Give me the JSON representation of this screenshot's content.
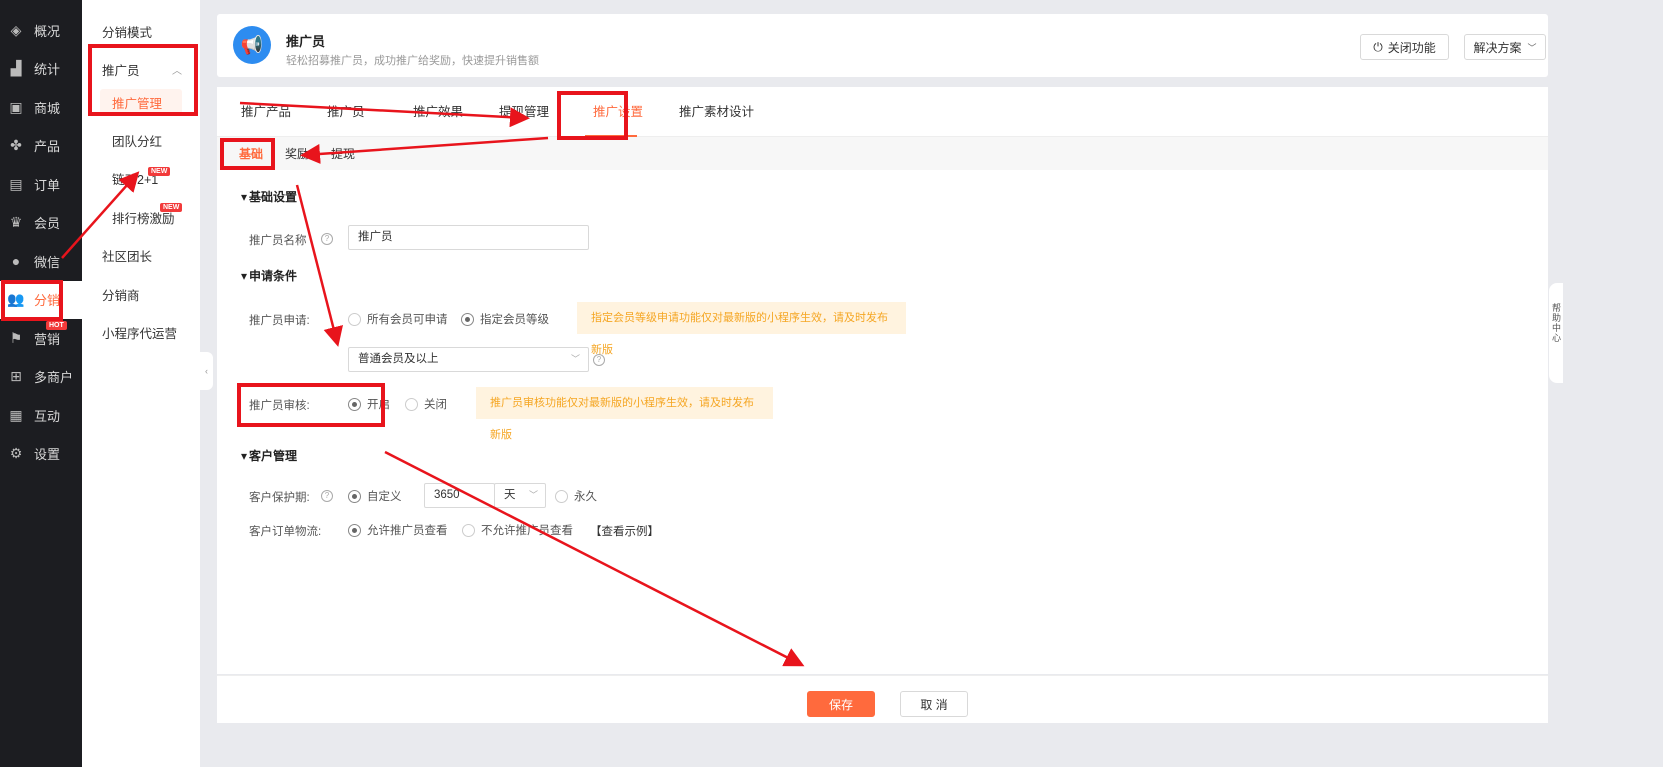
{
  "nav": [
    {
      "label": "概况",
      "icon": "layers-icon",
      "glyph": "◈"
    },
    {
      "label": "统计",
      "icon": "chart-icon",
      "glyph": "▟"
    },
    {
      "label": "商城",
      "icon": "store-icon",
      "glyph": "▣"
    },
    {
      "label": "产品",
      "icon": "product-icon",
      "glyph": "✤"
    },
    {
      "label": "订单",
      "icon": "order-icon",
      "glyph": "▤"
    },
    {
      "label": "会员",
      "icon": "crown-icon",
      "glyph": "♛"
    },
    {
      "label": "微信",
      "icon": "wechat-icon",
      "glyph": "●"
    },
    {
      "label": "分销",
      "icon": "users-icon",
      "glyph": "👥"
    },
    {
      "label": "营销",
      "icon": "flag-icon",
      "glyph": "⚑",
      "badge": "HOT"
    },
    {
      "label": "多商户",
      "icon": "merchant-icon",
      "glyph": "⊞"
    },
    {
      "label": "互动",
      "icon": "interact-icon",
      "glyph": "▦"
    },
    {
      "label": "设置",
      "icon": "gear-icon",
      "glyph": "⚙"
    }
  ],
  "sub": {
    "mode": "分销模式",
    "promoter": "推广员",
    "promoter_manage": "推广管理",
    "team_bonus": "团队分红",
    "linkage": "链动2+1",
    "ranking": "排行榜激励",
    "community": "社区团长",
    "distributor": "分销商",
    "miniapp": "小程序代运营",
    "new_badge": "NEW"
  },
  "header": {
    "title": "推广员",
    "desc": "轻松招募推广员，成功推广给奖励，快速提升销售额",
    "close_btn": "关闭功能",
    "solution_btn": "解决方案"
  },
  "tabs": [
    "推广产品",
    "推广员",
    "推广效果",
    "提现管理",
    "推广设置",
    "推广素材设计"
  ],
  "subtabs": [
    "基础",
    "奖励",
    "提现"
  ],
  "form": {
    "sec_basic": "基础设置",
    "name_label": "推广员名称",
    "name_value": "推广员",
    "sec_apply": "申请条件",
    "apply_label": "推广员申请:",
    "apply_all": "所有会员可申请",
    "apply_level": "指定会员等级",
    "apply_tip": "指定会员等级申请功能仅对最新版的小程序生效，请及时发布新版",
    "level_select": "普通会员及以上",
    "audit_label": "推广员审核:",
    "audit_on": "开启",
    "audit_off": "关闭",
    "audit_tip": "推广员审核功能仅对最新版的小程序生效，请及时发布新版",
    "sec_customer": "客户管理",
    "protect_label": "客户保护期:",
    "protect_custom": "自定义",
    "protect_days": "3650",
    "protect_unit": "天",
    "protect_forever": "永久",
    "logistics_label": "客户订单物流:",
    "logistics_allow": "允许推广员查看",
    "logistics_deny": "不允许推广员查看",
    "logistics_example": "【查看示例】"
  },
  "footer": {
    "save": "保存",
    "cancel": "取 消"
  },
  "help": "帮助中心",
  "colors": {
    "accent": "#ff6a3d",
    "annotation": "#e8141c"
  }
}
